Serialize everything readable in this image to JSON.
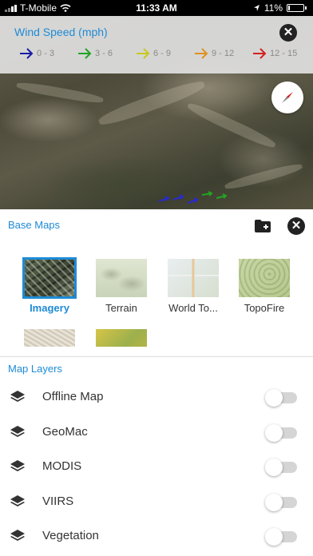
{
  "status_bar": {
    "carrier": "T-Mobile",
    "time": "11:33 AM",
    "battery": "11%"
  },
  "wind_legend": {
    "title": "Wind Speed (mph)",
    "items": [
      {
        "label": "0 - 3",
        "color": "#1a1aa8"
      },
      {
        "label": "3 - 6",
        "color": "#22a422"
      },
      {
        "label": "6 - 9",
        "color": "#c8c81e"
      },
      {
        "label": "9 - 12",
        "color": "#e0901e"
      },
      {
        "label": "12 - 15",
        "color": "#d42020"
      }
    ]
  },
  "panel": {
    "base_maps_title": "Base Maps",
    "base_maps": [
      {
        "label": "Imagery",
        "selected": true
      },
      {
        "label": "Terrain",
        "selected": false
      },
      {
        "label": "World To...",
        "selected": false
      },
      {
        "label": "TopoFire",
        "selected": false
      }
    ],
    "map_layers_title": "Map Layers",
    "layers": [
      {
        "label": "Offline Map",
        "enabled": false
      },
      {
        "label": "GeoMac",
        "enabled": false
      },
      {
        "label": "MODIS",
        "enabled": false
      },
      {
        "label": "VIIRS",
        "enabled": false
      },
      {
        "label": "Vegetation",
        "enabled": false
      }
    ]
  },
  "colors": {
    "accent": "#1e8bd6"
  }
}
